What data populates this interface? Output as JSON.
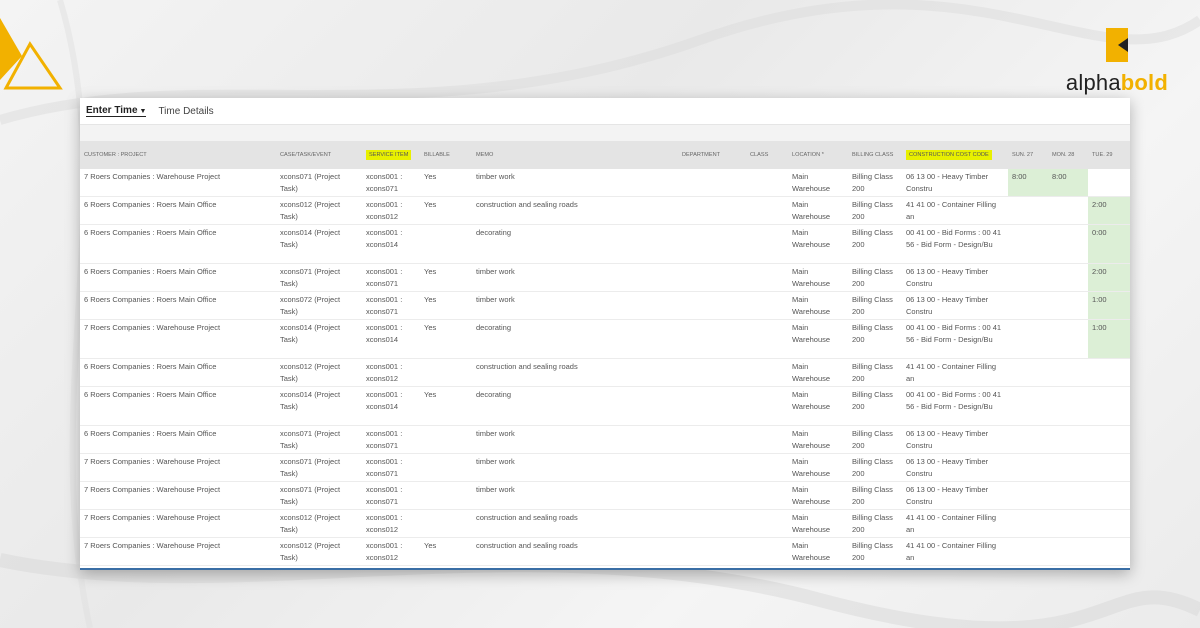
{
  "brand": {
    "name_part1": "alpha",
    "name_part2": "bold",
    "accent": "#f2b100"
  },
  "tabs": {
    "enter_time": "Enter Time",
    "time_details": "Time Details"
  },
  "columns": {
    "customer": "CUSTOMER : PROJECT",
    "case": "CASE/TASK/EVENT",
    "service": "SERVICE ITEM",
    "billable": "BILLABLE",
    "memo": "MEMO",
    "department": "DEPARTMENT",
    "class": "CLASS",
    "location": "LOCATION *",
    "billing": "BILLING CLASS",
    "ccc": "CONSTRUCTION COST CODE",
    "sun": "SUN. 27",
    "mon": "MON. 28",
    "tue": "TUE. 29"
  },
  "rows": [
    {
      "customer": "7 Roers Companies : Warehouse Project",
      "case": "xcons071 (Project Task)",
      "service": "xcons001 : xcons071",
      "billable": "Yes",
      "memo": "timber work",
      "location": "Main Warehouse",
      "billing": "Billing Class 200",
      "ccc": "06 13 00 - Heavy Timber Constru",
      "sun": "8:00",
      "mon": "8:00",
      "tue": ""
    },
    {
      "customer": "6 Roers Companies : Roers Main Office",
      "case": "xcons012 (Project Task)",
      "service": "xcons001 : xcons012",
      "billable": "Yes",
      "memo": "construction and sealing roads",
      "location": "Main Warehouse",
      "billing": "Billing Class 200",
      "ccc": "41 41 00 - Container Filling an",
      "sun": "",
      "mon": "",
      "tue": "2:00"
    },
    {
      "customer": "6 Roers Companies : Roers Main Office",
      "case": "xcons014 (Project Task)",
      "service": "xcons001 : xcons014",
      "billable": "",
      "memo": "decorating",
      "location": "Main Warehouse",
      "billing": "Billing Class 200",
      "ccc": "00 41 00 - Bid Forms : 00 41 56 - Bid Form - Design/Bu",
      "sun": "",
      "mon": "",
      "tue": "0:00"
    },
    {
      "customer": "6 Roers Companies : Roers Main Office",
      "case": "xcons071 (Project Task)",
      "service": "xcons001 : xcons071",
      "billable": "Yes",
      "memo": "timber work",
      "location": "Main Warehouse",
      "billing": "Billing Class 200",
      "ccc": "06 13 00 - Heavy Timber Constru",
      "sun": "",
      "mon": "",
      "tue": "2:00"
    },
    {
      "customer": "6 Roers Companies : Roers Main Office",
      "case": "xcons072 (Project Task)",
      "service": "xcons001 : xcons071",
      "billable": "Yes",
      "memo": "timber work",
      "location": "Main Warehouse",
      "billing": "Billing Class 200",
      "ccc": "06 13 00 - Heavy Timber Constru",
      "sun": "",
      "mon": "",
      "tue": "1:00"
    },
    {
      "customer": "7 Roers Companies : Warehouse Project",
      "case": "xcons014 (Project Task)",
      "service": "xcons001 : xcons014",
      "billable": "Yes",
      "memo": "decorating",
      "location": "Main Warehouse",
      "billing": "Billing Class 200",
      "ccc": "00 41 00 - Bid Forms : 00 41 56 - Bid Form - Design/Bu",
      "sun": "",
      "mon": "",
      "tue": "1:00"
    },
    {
      "customer": "6 Roers Companies : Roers Main Office",
      "case": "xcons012 (Project Task)",
      "service": "xcons001 : xcons012",
      "billable": "",
      "memo": "construction and sealing roads",
      "location": "Main Warehouse",
      "billing": "Billing Class 200",
      "ccc": "41 41 00 - Container Filling an",
      "sun": "",
      "mon": "",
      "tue": ""
    },
    {
      "customer": "6 Roers Companies : Roers Main Office",
      "case": "xcons014 (Project Task)",
      "service": "xcons001 : xcons014",
      "billable": "Yes",
      "memo": "decorating",
      "location": "Main Warehouse",
      "billing": "Billing Class 200",
      "ccc": "00 41 00 - Bid Forms : 00 41 56 - Bid Form - Design/Bu",
      "sun": "",
      "mon": "",
      "tue": ""
    },
    {
      "customer": "6 Roers Companies : Roers Main Office",
      "case": "xcons071 (Project Task)",
      "service": "xcons001 : xcons071",
      "billable": "",
      "memo": "timber work",
      "location": "Main Warehouse",
      "billing": "Billing Class 200",
      "ccc": "06 13 00 - Heavy Timber Constru",
      "sun": "",
      "mon": "",
      "tue": ""
    },
    {
      "customer": "7 Roers Companies : Warehouse Project",
      "case": "xcons071 (Project Task)",
      "service": "xcons001 : xcons071",
      "billable": "",
      "memo": "timber work",
      "location": "Main Warehouse",
      "billing": "Billing Class 200",
      "ccc": "06 13 00 - Heavy Timber Constru",
      "sun": "",
      "mon": "",
      "tue": ""
    },
    {
      "customer": "7 Roers Companies : Warehouse Project",
      "case": "xcons071 (Project Task)",
      "service": "xcons001 : xcons071",
      "billable": "",
      "memo": "timber work",
      "location": "Main Warehouse",
      "billing": "Billing Class 200",
      "ccc": "06 13 00 - Heavy Timber Constru",
      "sun": "",
      "mon": "",
      "tue": ""
    },
    {
      "customer": "7 Roers Companies : Warehouse Project",
      "case": "xcons012 (Project Task)",
      "service": "xcons001 : xcons012",
      "billable": "",
      "memo": "construction and sealing roads",
      "location": "Main Warehouse",
      "billing": "Billing Class 200",
      "ccc": "41 41 00 - Container Filling an",
      "sun": "",
      "mon": "",
      "tue": ""
    },
    {
      "customer": "7 Roers Companies : Warehouse Project",
      "case": "xcons012 (Project Task)",
      "service": "xcons001 : xcons012",
      "billable": "Yes",
      "memo": "construction and sealing roads",
      "location": "Main Warehouse",
      "billing": "Billing Class 200",
      "ccc": "41 41 00 - Container Filling an",
      "sun": "",
      "mon": "",
      "tue": ""
    }
  ]
}
